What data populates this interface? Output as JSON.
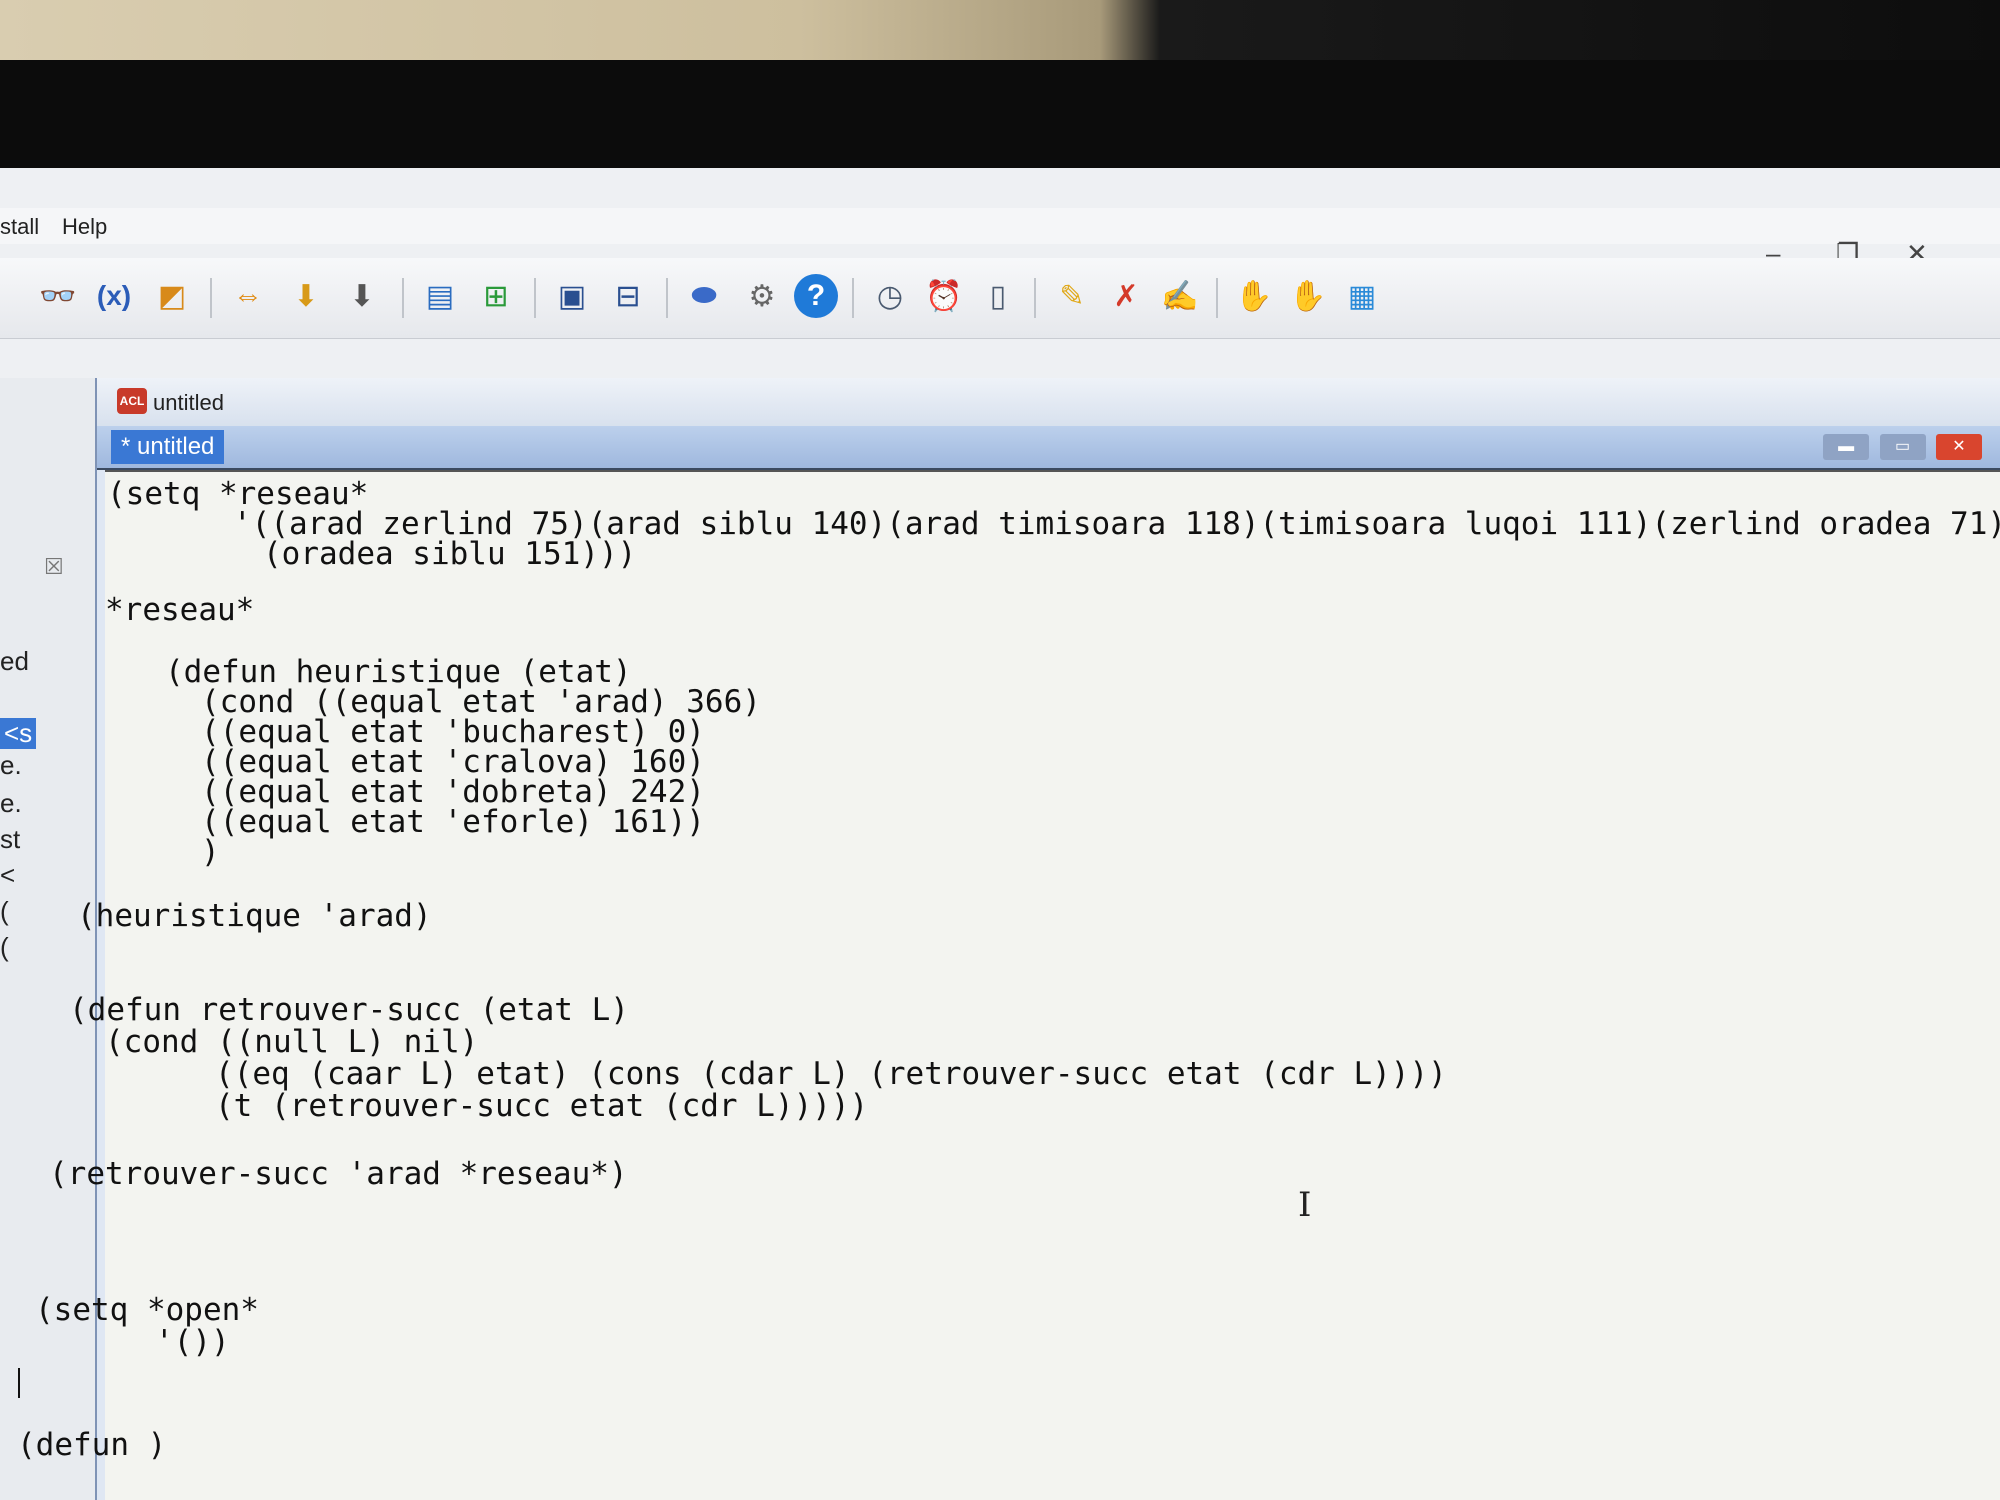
{
  "menu": {
    "install_label": "stall",
    "help_label": "Help"
  },
  "window_controls": {
    "minimize": "–",
    "restore": "❐",
    "close": "✕"
  },
  "toolbar": {
    "icons": [
      "binoculars-icon",
      "variable-x-icon",
      "inspect-icon",
      "arrows-icon",
      "load-icon",
      "save-icon",
      "window-icon",
      "tree-icon",
      "listener-icon",
      "debug-icon",
      "component-icon",
      "settings-icon",
      "help-icon",
      "clock-icon",
      "alarm-icon",
      "doc-clock-icon",
      "edit-icon",
      "clear-edit-icon",
      "notes-icon",
      "stop-icon",
      "break-icon",
      "folder-icon"
    ],
    "variable_label": "(x)",
    "help_glyph": "?"
  },
  "left_pane": {
    "labels": [
      "ed",
      "<s",
      "e.",
      "e.",
      "st",
      "<",
      "(",
      "("
    ],
    "close_glyph": "☒"
  },
  "editor": {
    "title": "untitled",
    "icon_label": "ACL",
    "tab_label": "* untitled",
    "lines": [
      "(setq *reseau*",
      "'((arad zerlind 75)(arad siblu 140)(arad timisoara 118)(timisoara luqoi 111)(zerlind oradea 71)",
      "(oradea siblu 151)))",
      "*reseau*",
      "(defun heuristique (etat)",
      "(cond ((equal etat 'arad) 366)",
      "((equal etat 'bucharest) 0)",
      "((equal etat 'cralova) 160)",
      "((equal etat 'dobreta) 242)",
      "((equal etat 'eforle) 161))",
      ")",
      "(heuristique 'arad)",
      "(defun retrouver-succ (etat L)",
      "(cond ((null L) nil)",
      "((eq (caar L) etat) (cons (cdar L) (retrouver-succ etat (cdr L))))",
      "(t (retrouver-succ etat (cdr L)))))",
      "(retrouver-succ 'arad *reseau*)",
      "(setq *open*",
      "'())",
      "(defun )"
    ]
  }
}
